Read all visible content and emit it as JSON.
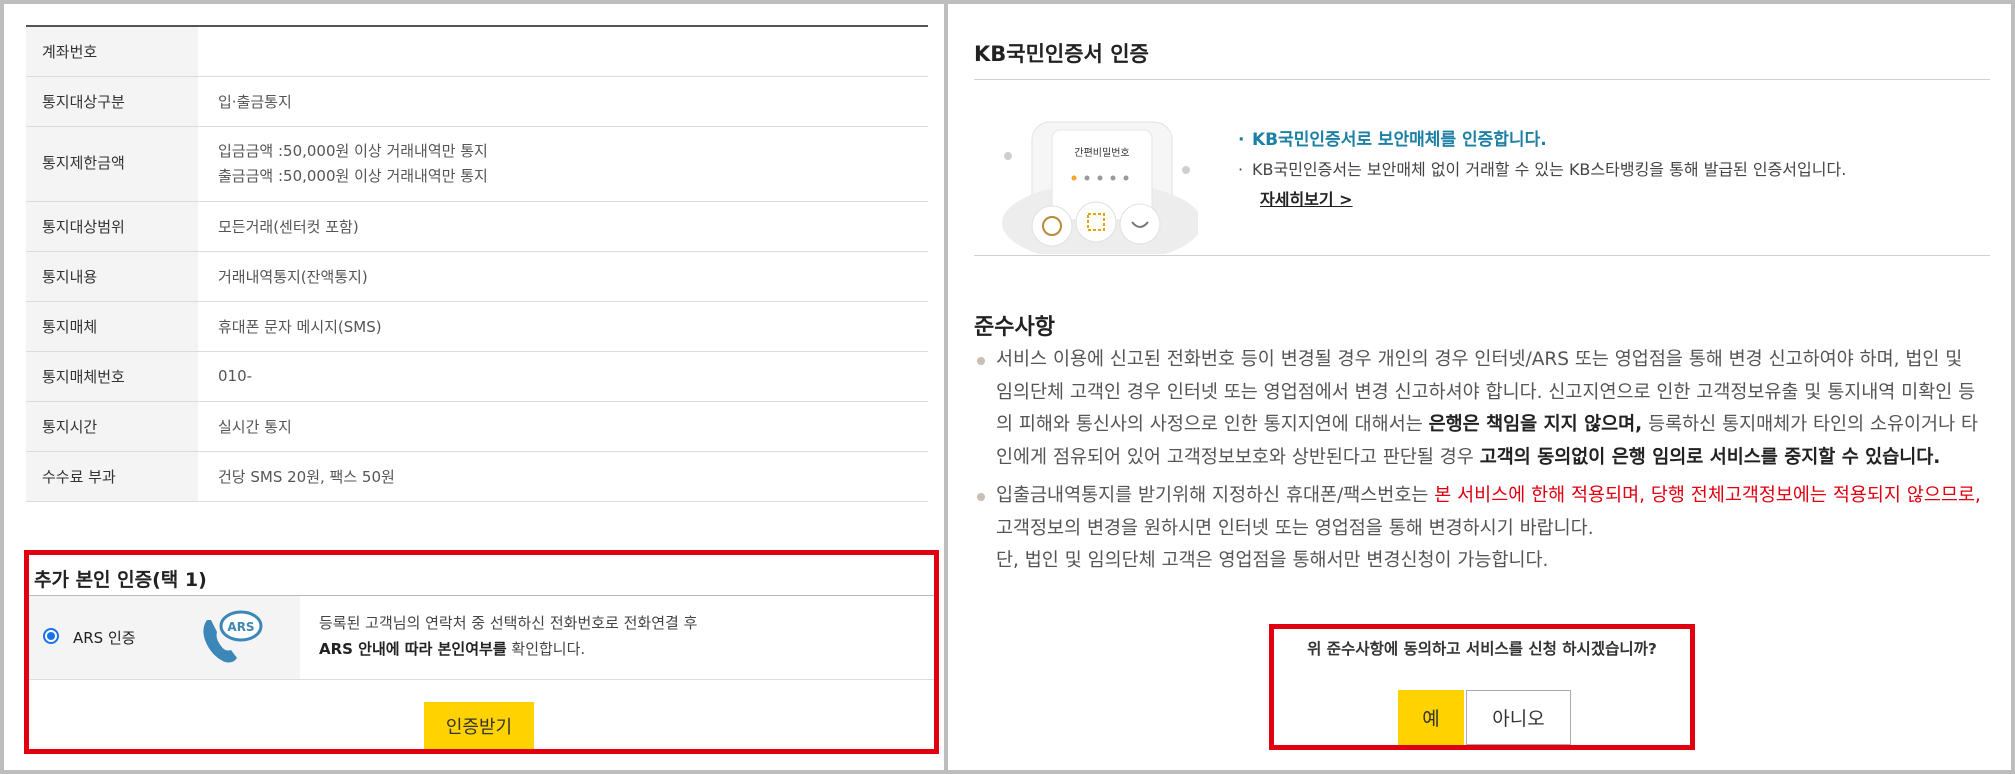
{
  "info_table": {
    "rows": [
      {
        "label": "계좌번호",
        "values": [
          ""
        ]
      },
      {
        "label": "통지대상구분",
        "values": [
          "입·출금통지"
        ]
      },
      {
        "label": "통지제한금액",
        "values": [
          "입금금액 :50,000원 이상 거래내역만 통지",
          "출금금액 :50,000원 이상 거래내역만 통지"
        ]
      },
      {
        "label": "통지대상범위",
        "values": [
          "모든거래(센터컷 포함)"
        ]
      },
      {
        "label": "통지내용",
        "values": [
          "거래내역통지(잔액통지)"
        ]
      },
      {
        "label": "통지매체",
        "values": [
          "휴대폰 문자 메시지(SMS)"
        ]
      },
      {
        "label": "통지매체번호",
        "values": [
          "010-"
        ]
      },
      {
        "label": "통지시간",
        "values": [
          "실시간 통지"
        ]
      },
      {
        "label": "수수료 부과",
        "values": [
          "건당 SMS 20원, 팩스 50원"
        ]
      }
    ]
  },
  "auth": {
    "title": "추가 본인 인증(택 1)",
    "option_label": "ARS 인증",
    "option_selected": true,
    "icon_text": "ARS",
    "desc_line1": "등록된 고객님의 연락처 중 선택하신 전화번호로 전화연결 후",
    "desc_line2_bold": "ARS 안내에 따라 본인여부를",
    "desc_line2_rest": " 확인합니다.",
    "button_label": "인증받기"
  },
  "kb_cert": {
    "title": "KB국민인증서 인증",
    "phone_label": "간편비밀번호",
    "bullet_bold": "KB국민인증서로 보안매체를 인증합니다.",
    "bullet_text": "KB국민인증서는 보안매체 없이 거래할 수 있는 KB스타뱅킹을 통해 발급된 인증서입니다.",
    "more_link": "자세히보기 >"
  },
  "notice": {
    "title": "준수사항",
    "item1": {
      "text_a": "서비스 이용에 신고된 전화번호 등이 변경될 경우 개인의 경우 인터넷/ARS 또는 영업점을 통해 변경 신고하여야 하며, 법인 및 임의단체 고객인 경우 인터넷 또는 영업점에서 변경 신고하셔야 합니다. 신고지연으로 인한 고객정보유출 및 통지내역 미확인 등의 피해와 통신사의 사정으로 인한 통지지연에 대해서는 ",
      "bold_a": "은행은 책임을 지지 않으며,",
      "text_b": " 등록하신 통지매체가 타인의 소유이거나 타인에게 점유되어 있어 고객정보보호와 상반된다고 판단될 경우 ",
      "bold_b": "고객의 동의없이 은행 임의로 서비스를 중지할 수 있습니다."
    },
    "item2": {
      "text_a": "입출금내역통지를 받기위해 지정하신 휴대폰/팩스번호는 ",
      "red_a": "본 서비스에 한해 적용되며, 당행 전체고객정보에는 적용되지 않으므로,",
      "text_b": " 고객정보의 변경을 원하시면 인터넷 또는 영업점을 통해 변경하시기 바랍니다.",
      "line2": "단, 법인 및 임의단체 고객은 영업점을 통해서만 변경신청이 가능합니다."
    }
  },
  "confirm": {
    "question": "위 준수사항에 동의하고 서비스를 신청 하시겠습니까?",
    "yes_label": "예",
    "no_label": "아니오"
  },
  "colors": {
    "highlight_border": "#e1000f",
    "primary_button": "#ffd200",
    "kb_accent": "#1c7fa4"
  }
}
